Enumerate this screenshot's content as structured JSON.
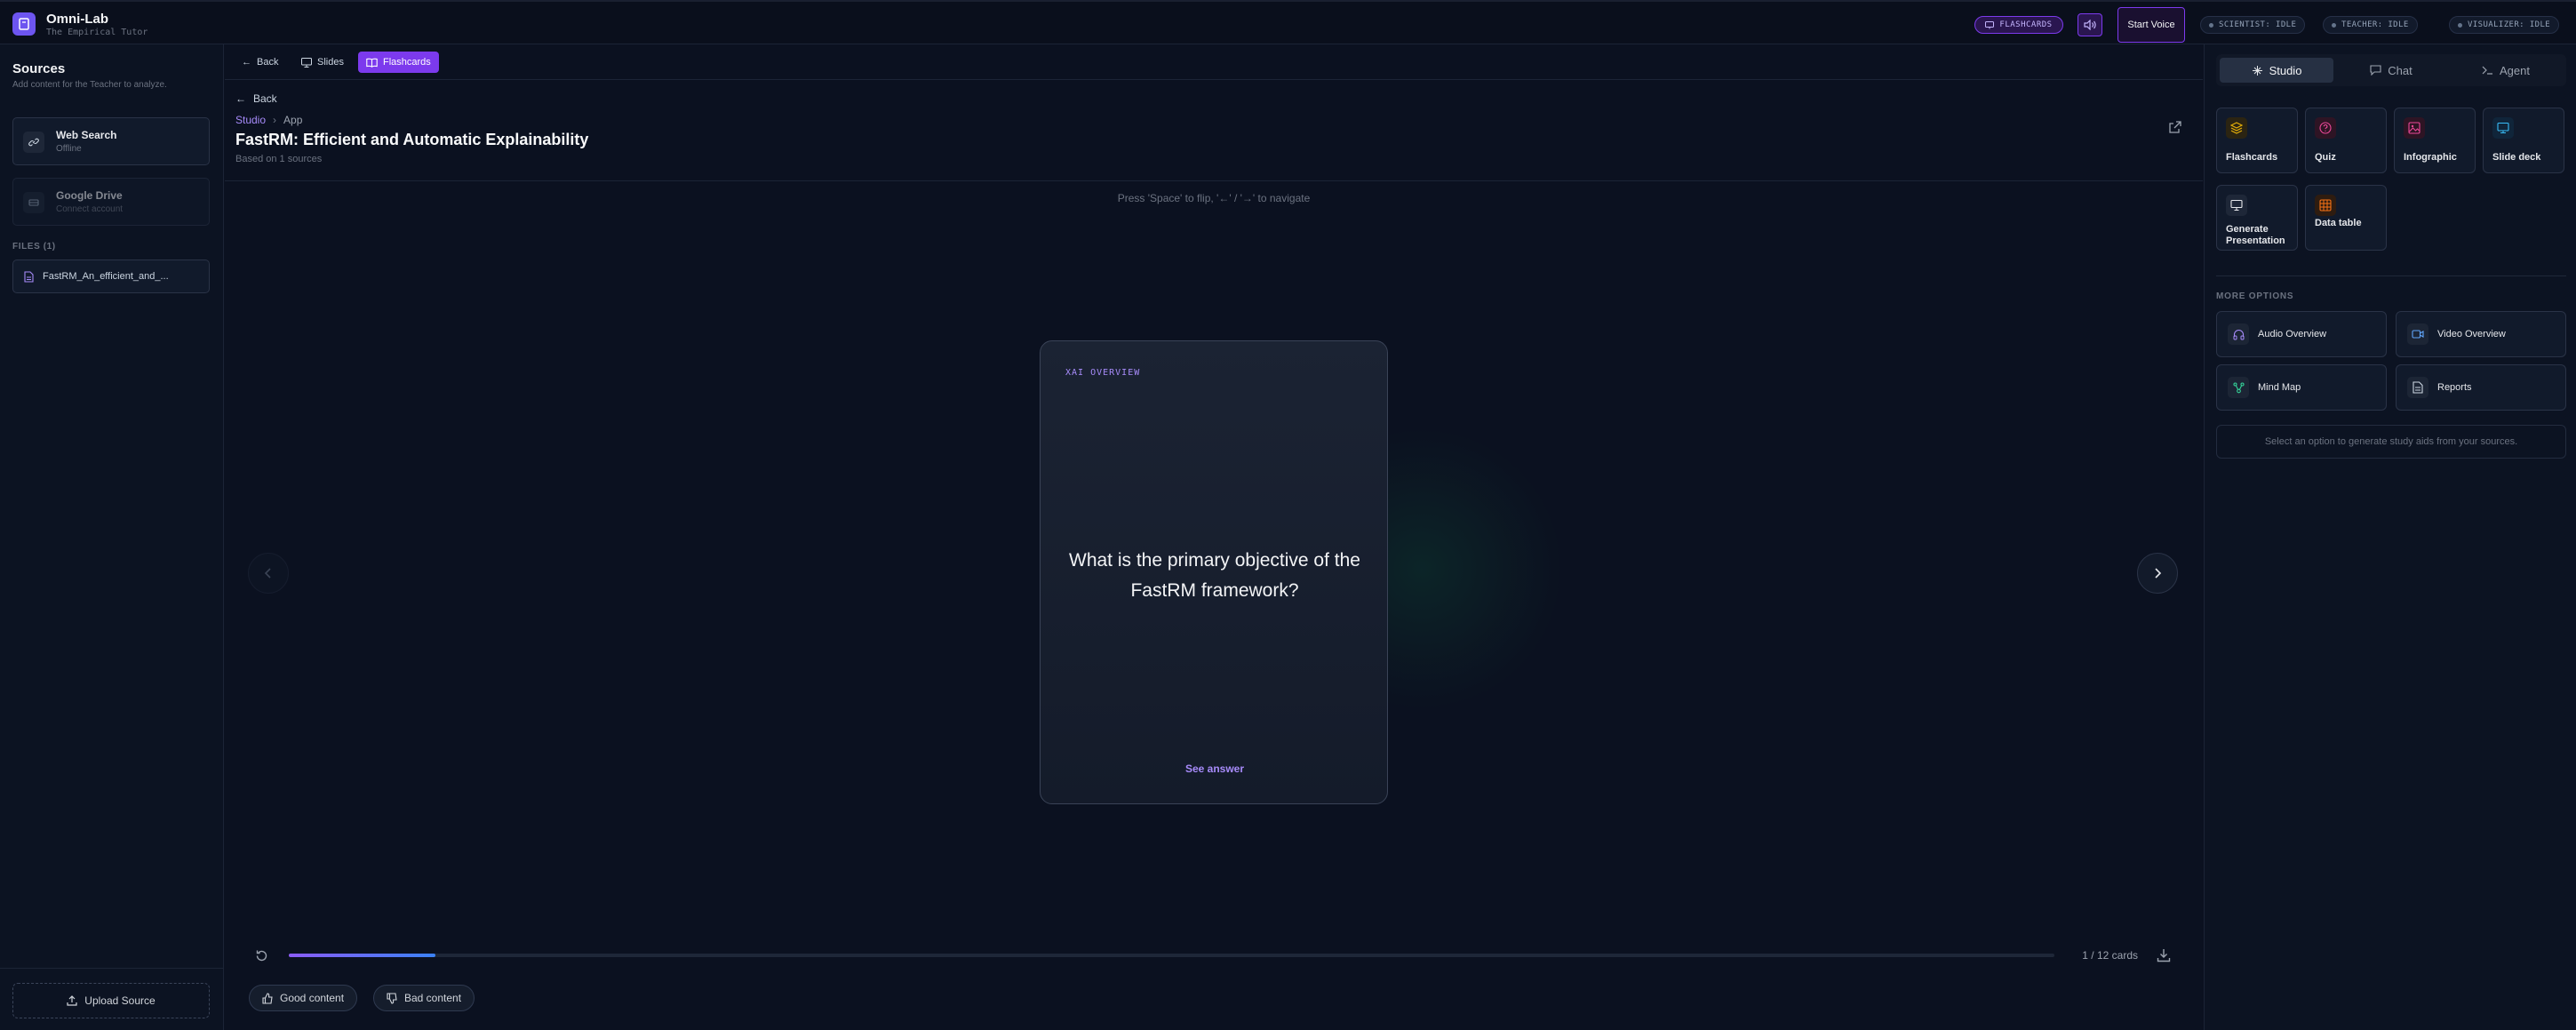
{
  "app": {
    "title": "Omni-Lab",
    "subtitle": "The Empirical Tutor"
  },
  "topbar": {
    "mode_pill": "FLASHCARDS",
    "start_voice": "Start Voice",
    "agents": [
      {
        "label": "SCIENTIST: IDLE"
      },
      {
        "label": "TEACHER: IDLE"
      },
      {
        "label": "VISUALIZER: IDLE"
      }
    ]
  },
  "sidebar": {
    "title": "Sources",
    "subtitle": "Add content for the Teacher to analyze.",
    "sources": [
      {
        "name": "Web Search",
        "status": "Offline"
      },
      {
        "name": "Google Drive",
        "status": "Connect account"
      }
    ],
    "files_label": "FILES (1)",
    "files": [
      {
        "name": "FastRM_An_efficient_and_..."
      }
    ],
    "upload_label": "Upload Source"
  },
  "main": {
    "toolbar": {
      "back": "Back",
      "slides": "Slides",
      "flashcards": "Flashcards"
    },
    "back_link": "Back",
    "breadcrumb": {
      "root": "Studio",
      "current": "App"
    },
    "title": "FastRM: Efficient and Automatic Explainability",
    "subtitle": "Based on 1 sources",
    "hint": "Press 'Space' to flip, '←' / '→' to navigate",
    "card": {
      "tag": "XAI OVERVIEW",
      "question": "What is the primary objective of the FastRM framework?",
      "answer_label": "See answer"
    },
    "progress": {
      "current": 1,
      "total": 12,
      "fraction": 0.083,
      "label": "1 / 12 cards"
    },
    "feedback": {
      "good": "Good content",
      "bad": "Bad content"
    }
  },
  "rpanel": {
    "tabs": [
      {
        "label": "Studio"
      },
      {
        "label": "Chat"
      },
      {
        "label": "Agent"
      }
    ],
    "tools": [
      {
        "label": "Flashcards",
        "icon": "layers-icon",
        "color": "#eab308"
      },
      {
        "label": "Quiz",
        "icon": "question-circle-icon",
        "color": "#ec4899"
      },
      {
        "label": "Infographic",
        "icon": "image-icon",
        "color": "#ec4899"
      },
      {
        "label": "Slide deck",
        "icon": "monitor-icon",
        "color": "#38bdf8"
      },
      {
        "label": "Generate Presentation",
        "icon": "presentation-icon",
        "color": "#e5e7eb"
      },
      {
        "label": "Data table",
        "icon": "table-icon",
        "color": "#f97316"
      }
    ],
    "more_label": "MORE OPTIONS",
    "options": [
      {
        "label": "Audio Overview",
        "icon": "headphones-icon"
      },
      {
        "label": "Video Overview",
        "icon": "video-icon"
      },
      {
        "label": "Mind Map",
        "icon": "mind-map-icon"
      },
      {
        "label": "Reports",
        "icon": "document-icon"
      }
    ],
    "hint": "Select an option to generate study aids from your sources."
  }
}
